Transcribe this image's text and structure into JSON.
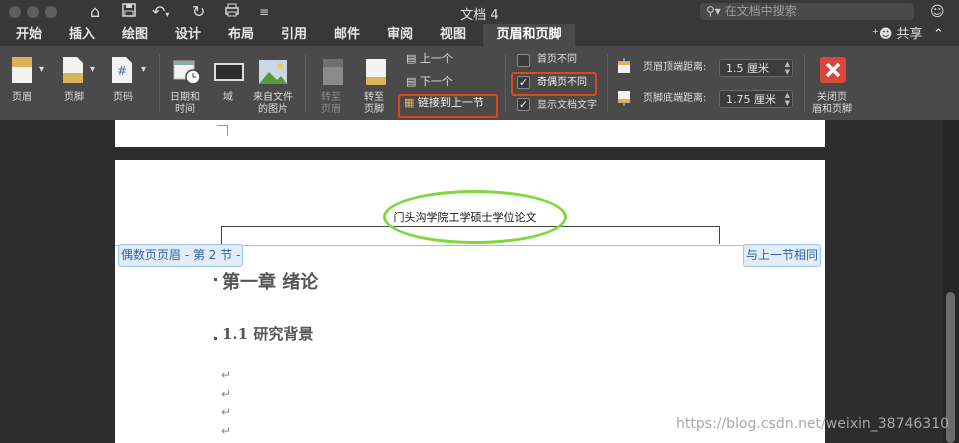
{
  "window": {
    "title": "文档 4"
  },
  "search": {
    "placeholder": "在文档中搜索"
  },
  "share": {
    "label": "共享"
  },
  "tabs": [
    "开始",
    "插入",
    "绘图",
    "设计",
    "布局",
    "引用",
    "邮件",
    "审阅",
    "视图",
    "页眉和页脚"
  ],
  "ribbon": {
    "header": "页眉",
    "footer": "页脚",
    "page_number": "页码",
    "date_time_1": "日期和",
    "date_time_2": "时间",
    "field": "域",
    "picture_1": "来自文件",
    "picture_2": "的图片",
    "goto_header_1": "转至",
    "goto_header_2": "页眉",
    "goto_footer_1": "转至",
    "goto_footer_2": "页脚",
    "previous": "上一个",
    "next": "下一个",
    "link_previous": "链接到上一节",
    "diff_first": "首页不同",
    "diff_odd_even": "奇偶页不同",
    "show_doc_text": "显示文档文字",
    "header_top_label": "页眉顶端距离:",
    "header_top_value": "1.5 厘米",
    "footer_bottom_label": "页脚底端距离:",
    "footer_bottom_value": "1.75 厘米",
    "close_1": "关闭页",
    "close_2": "眉和页脚"
  },
  "checkboxes": {
    "diff_first": false,
    "diff_odd_even": true,
    "show_doc_text": true
  },
  "document": {
    "header_text": "门头沟学院工学硕士学位论文",
    "header_tag_left": "偶数页页眉 - 第 2 节 -",
    "header_tag_right": "与上一节相同",
    "chapter_title": "第一章  绪论",
    "section_title": "1.1  研究背景",
    "para_mark": "↵"
  },
  "watermark": "https://blog.csdn.net/weixin_38746310",
  "colors": {
    "highlight_red": "#e2461c",
    "circle_green": "#7dd93f",
    "tab_active": "#4a4a4a"
  }
}
